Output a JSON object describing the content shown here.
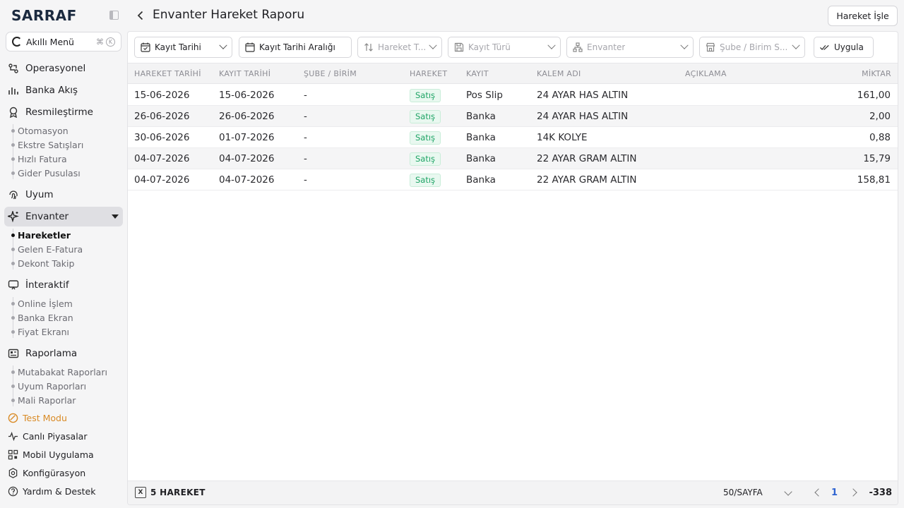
{
  "app": {
    "logo": "SARRAF"
  },
  "sidebar": {
    "smart_menu": {
      "label": "Akıllı Menü",
      "shortcut_cmd": "⌘",
      "shortcut_key": "K"
    },
    "sections": [
      {
        "label": "Operasyonel",
        "icon": "operations-icon"
      },
      {
        "label": "Banka Akış",
        "icon": "bank-flow-icon"
      },
      {
        "label": "Resmileştirme",
        "icon": "certificate-icon",
        "children": [
          "Otomasyon",
          "Ekstre Satışları",
          "Hızlı Fatura",
          "Gider Pusulası"
        ]
      },
      {
        "label": "Uyum",
        "icon": "fingerprint-icon"
      },
      {
        "label": "Envanter",
        "icon": "sparkle-icon",
        "active": true,
        "children": [
          "Hareketler",
          "Gelen E-Fatura",
          "Dekont Takip"
        ],
        "active_child": "Hareketler"
      },
      {
        "label": "İnteraktif",
        "icon": "interactive-icon",
        "children": [
          "Online İşlem",
          "Banka Ekran",
          "Fiyat Ekranı"
        ]
      },
      {
        "label": "Raporlama",
        "icon": "report-icon",
        "children": [
          "Mutabakat Raporları",
          "Uyum Raporları",
          "Mali Raporlar"
        ]
      }
    ],
    "bottom": [
      {
        "label": "Test Modu",
        "icon": "test-mode-icon",
        "color": "#d98a25"
      },
      {
        "label": "Canlı Piyasalar",
        "icon": "pulse-icon"
      },
      {
        "label": "Mobil Uygulama",
        "icon": "qr-icon"
      },
      {
        "label": "Konfigürasyon",
        "icon": "gear-icon"
      },
      {
        "label": "Yardım & Destek",
        "icon": "help-icon"
      }
    ]
  },
  "header": {
    "title": "Envanter Hareket Raporu",
    "primary_button": "Hareket İşle"
  },
  "filters": {
    "date_type": "Kayıt Tarihi",
    "date_range": "Kayıt Tarihi Aralığı",
    "movement_type": "Hareket T...",
    "record_type": "Kayıt Türü",
    "inventory": "Envanter",
    "branch": "Şube / Birim S...",
    "apply": "Uygula"
  },
  "table": {
    "columns": [
      "HAREKET TARİHİ",
      "KAYIT TARİHİ",
      "ŞUBE / BİRİM",
      "HAREKET",
      "KAYIT",
      "KALEM ADI",
      "AÇIKLAMA",
      "MİKTAR"
    ],
    "rows": [
      {
        "movement_date": "15-06-2026",
        "record_date": "15-06-2026",
        "branch": "-",
        "movement": "Satış",
        "record": "Pos Slip",
        "item": "24 AYAR HAS ALTIN",
        "description": "",
        "amount": "161,00"
      },
      {
        "movement_date": "26-06-2026",
        "record_date": "26-06-2026",
        "branch": "-",
        "movement": "Satış",
        "record": "Banka",
        "item": "24 AYAR HAS ALTIN",
        "description": "",
        "amount": "2,00"
      },
      {
        "movement_date": "30-06-2026",
        "record_date": "01-07-2026",
        "branch": "-",
        "movement": "Satış",
        "record": "Banka",
        "item": "14K KOLYE",
        "description": "",
        "amount": "0,88"
      },
      {
        "movement_date": "04-07-2026",
        "record_date": "04-07-2026",
        "branch": "-",
        "movement": "Satış",
        "record": "Banka",
        "item": "22 AYAR GRAM ALTIN",
        "description": "",
        "amount": "15,79"
      },
      {
        "movement_date": "04-07-2026",
        "record_date": "04-07-2026",
        "branch": "-",
        "movement": "Satış",
        "record": "Banka",
        "item": "22 AYAR GRAM ALTIN",
        "description": "",
        "amount": "158,81"
      }
    ]
  },
  "footer": {
    "count": "5 HAREKET",
    "per_page": "50/SAYFA",
    "page": "1",
    "total": "-338"
  },
  "colors": {
    "badge_green": "#1ea465",
    "accent_blue": "#2e63d1",
    "test_mode_orange": "#d98a25"
  }
}
